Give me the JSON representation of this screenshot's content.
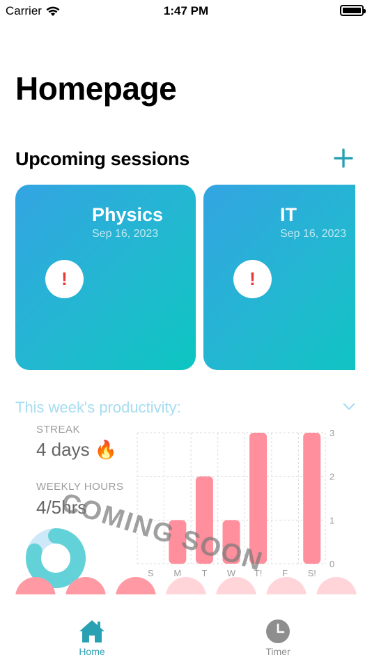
{
  "status_bar": {
    "carrier": "Carrier",
    "time": "1:47 PM"
  },
  "page_title": "Homepage",
  "upcoming": {
    "title": "Upcoming sessions",
    "sessions": [
      {
        "subject": "Physics",
        "date": "Sep 16, 2023",
        "badge": "!"
      },
      {
        "subject": "IT",
        "date": "Sep 16, 2023",
        "badge": "!"
      }
    ]
  },
  "productivity": {
    "title": "This week's productivity:",
    "streak_label": "STREAK",
    "streak_value": "4 days 🔥",
    "hours_label": "WEEKLY HOURS",
    "hours_value": "4/5hrs",
    "overlay": "COMING SOON",
    "hours_progress": 0.8
  },
  "chart_data": {
    "type": "bar",
    "categories": [
      "S",
      "M",
      "T",
      "W",
      "T!",
      "F",
      "S!"
    ],
    "values": [
      0,
      1,
      2,
      1,
      3,
      0,
      3
    ],
    "ylim": [
      0,
      3
    ],
    "yticks": [
      0,
      1,
      2,
      3
    ],
    "bar_color": "#ff8f9c",
    "grid": true
  },
  "colors": {
    "accent": "#2aa1b3",
    "card_start": "#33a4e2",
    "card_end": "#0cc6c0",
    "bar": "#ff8f9c"
  },
  "tabs": [
    {
      "label": "Home",
      "icon": "house-icon",
      "active": true
    },
    {
      "label": "Timer",
      "icon": "clock-icon",
      "active": false
    }
  ]
}
